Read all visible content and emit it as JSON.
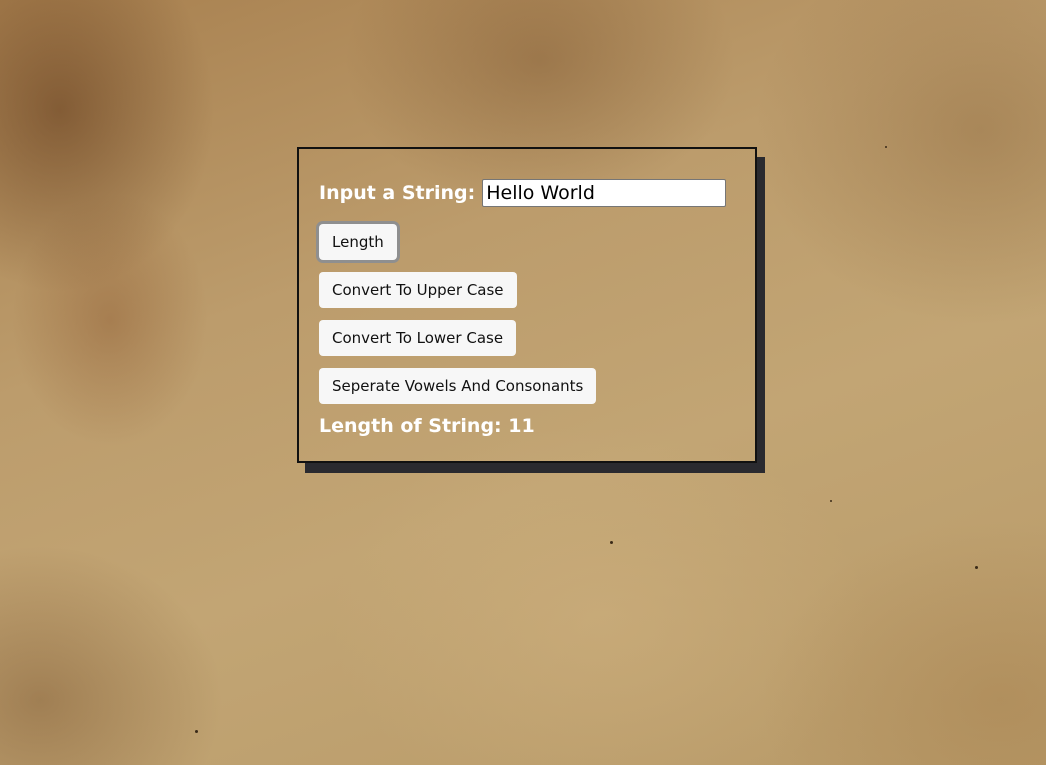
{
  "form": {
    "input_label": "Input a String:",
    "input_value": "Hello World",
    "buttons": {
      "length": "Length",
      "upper": "Convert To Upper Case",
      "lower": "Convert To Lower Case",
      "vowels": "Seperate Vowels And Consonants"
    },
    "result_label": "Length of String:",
    "result_value": "11"
  },
  "colors": {
    "panel_border": "#111111",
    "panel_shadow": "#2a2a2f",
    "label_text": "#ffffff",
    "button_bg": "#f7f7f7"
  }
}
